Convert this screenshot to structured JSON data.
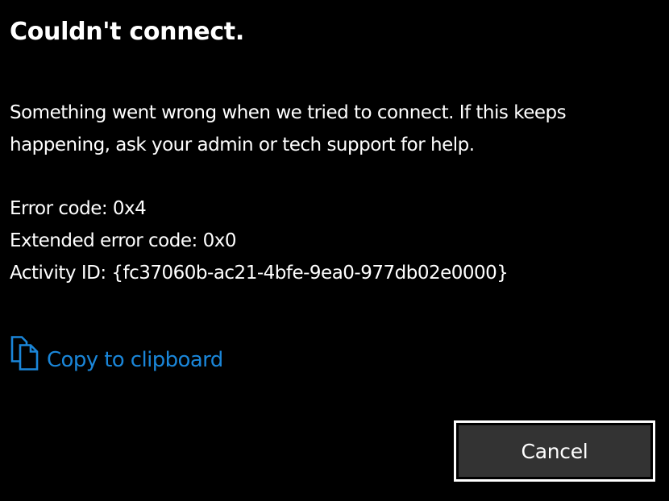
{
  "dialog": {
    "title": "Couldn't connect.",
    "message_line1": "Something went wrong when we tried to connect. If this keeps",
    "message_line2": "happening, ask your admin or tech support for help.",
    "error_code": "Error code: 0x4",
    "extended_error_code": "Extended error code: 0x0",
    "activity_id": "Activity ID: {fc37060b-ac21-4bfe-9ea0-977db02e0000}",
    "copy_link": {
      "label": "Copy to clipboard",
      "icon": "copy-icon"
    },
    "cancel_label": "Cancel"
  },
  "colors": {
    "background": "#000000",
    "text": "#ffffff",
    "link": "#0078d7",
    "button_fill": "#333333",
    "button_border": "#ffffff"
  }
}
